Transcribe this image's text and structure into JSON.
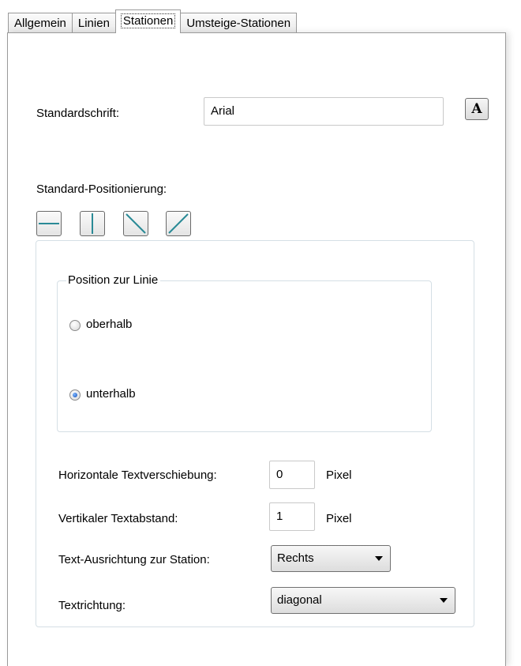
{
  "tabs": [
    {
      "label": "Allgemein",
      "active": false
    },
    {
      "label": "Linien",
      "active": false
    },
    {
      "label": "Stationen",
      "active": true
    },
    {
      "label": "Umsteige-Stationen",
      "active": false
    }
  ],
  "font": {
    "label": "Standardschrift:",
    "value": "Arial",
    "button_label": "A"
  },
  "positioning": {
    "label": "Standard-Positionierung:",
    "buttons": [
      "horizontal-line-icon",
      "vertical-line-icon",
      "diagonal-down-icon",
      "diagonal-up-icon"
    ],
    "accent_color": "#2a8a96"
  },
  "position_group": {
    "legend": "Position zur Linie",
    "options": [
      {
        "label": "oberhalb",
        "checked": false
      },
      {
        "label": "unterhalb",
        "checked": true
      }
    ]
  },
  "settings": {
    "horizontal_shift": {
      "label": "Horizontale Textverschiebung:",
      "value": "0",
      "unit": "Pixel"
    },
    "vertical_spacing": {
      "label": "Vertikaler Textabstand:",
      "value": "1",
      "unit": "Pixel"
    },
    "alignment": {
      "label": "Text-Ausrichtung zur Station:",
      "selected": "Rechts"
    },
    "direction": {
      "label": "Textrichtung:",
      "selected": "diagonal"
    }
  }
}
